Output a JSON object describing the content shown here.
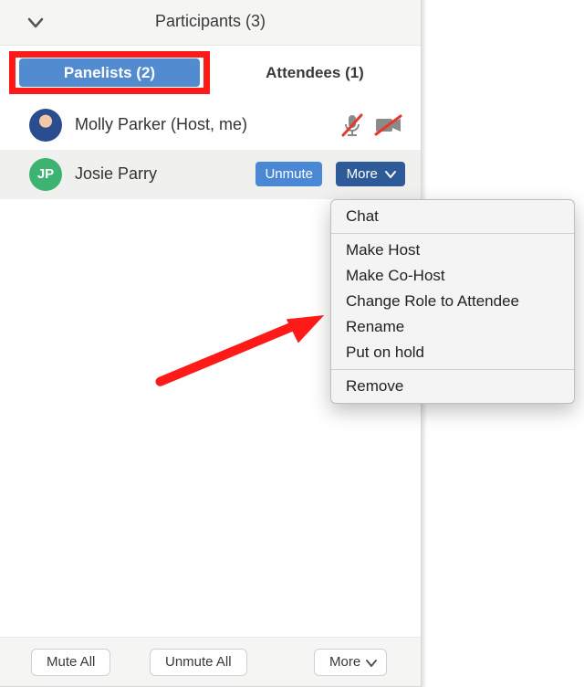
{
  "header": {
    "title": "Participants (3)"
  },
  "tabs": {
    "panelists_label": "Panelists (2)",
    "attendees_label": "Attendees (1)"
  },
  "participants": [
    {
      "name": "Molly Parker (Host, me)",
      "initials": "",
      "mic_muted": true,
      "cam_off": true
    },
    {
      "name": "Josie Parry",
      "initials": "JP",
      "mic_muted": false,
      "cam_off": false
    }
  ],
  "row_actions": {
    "unmute_label": "Unmute",
    "more_label": "More"
  },
  "dropdown": {
    "items_group1": [
      "Chat"
    ],
    "items_group2": [
      "Make Host",
      "Make Co-Host",
      "Change Role to Attendee",
      "Rename",
      "Put on hold"
    ],
    "items_group3": [
      "Remove"
    ]
  },
  "bottom": {
    "mute_all": "Mute All",
    "unmute_all": "Unmute All",
    "more": "More"
  },
  "colors": {
    "tab_active_bg": "#528bd0",
    "btn_blue": "#4a88d6",
    "btn_blue_dark": "#2f5a99",
    "highlight_red": "#ff1a1a",
    "avatar_green": "#3cb371"
  }
}
